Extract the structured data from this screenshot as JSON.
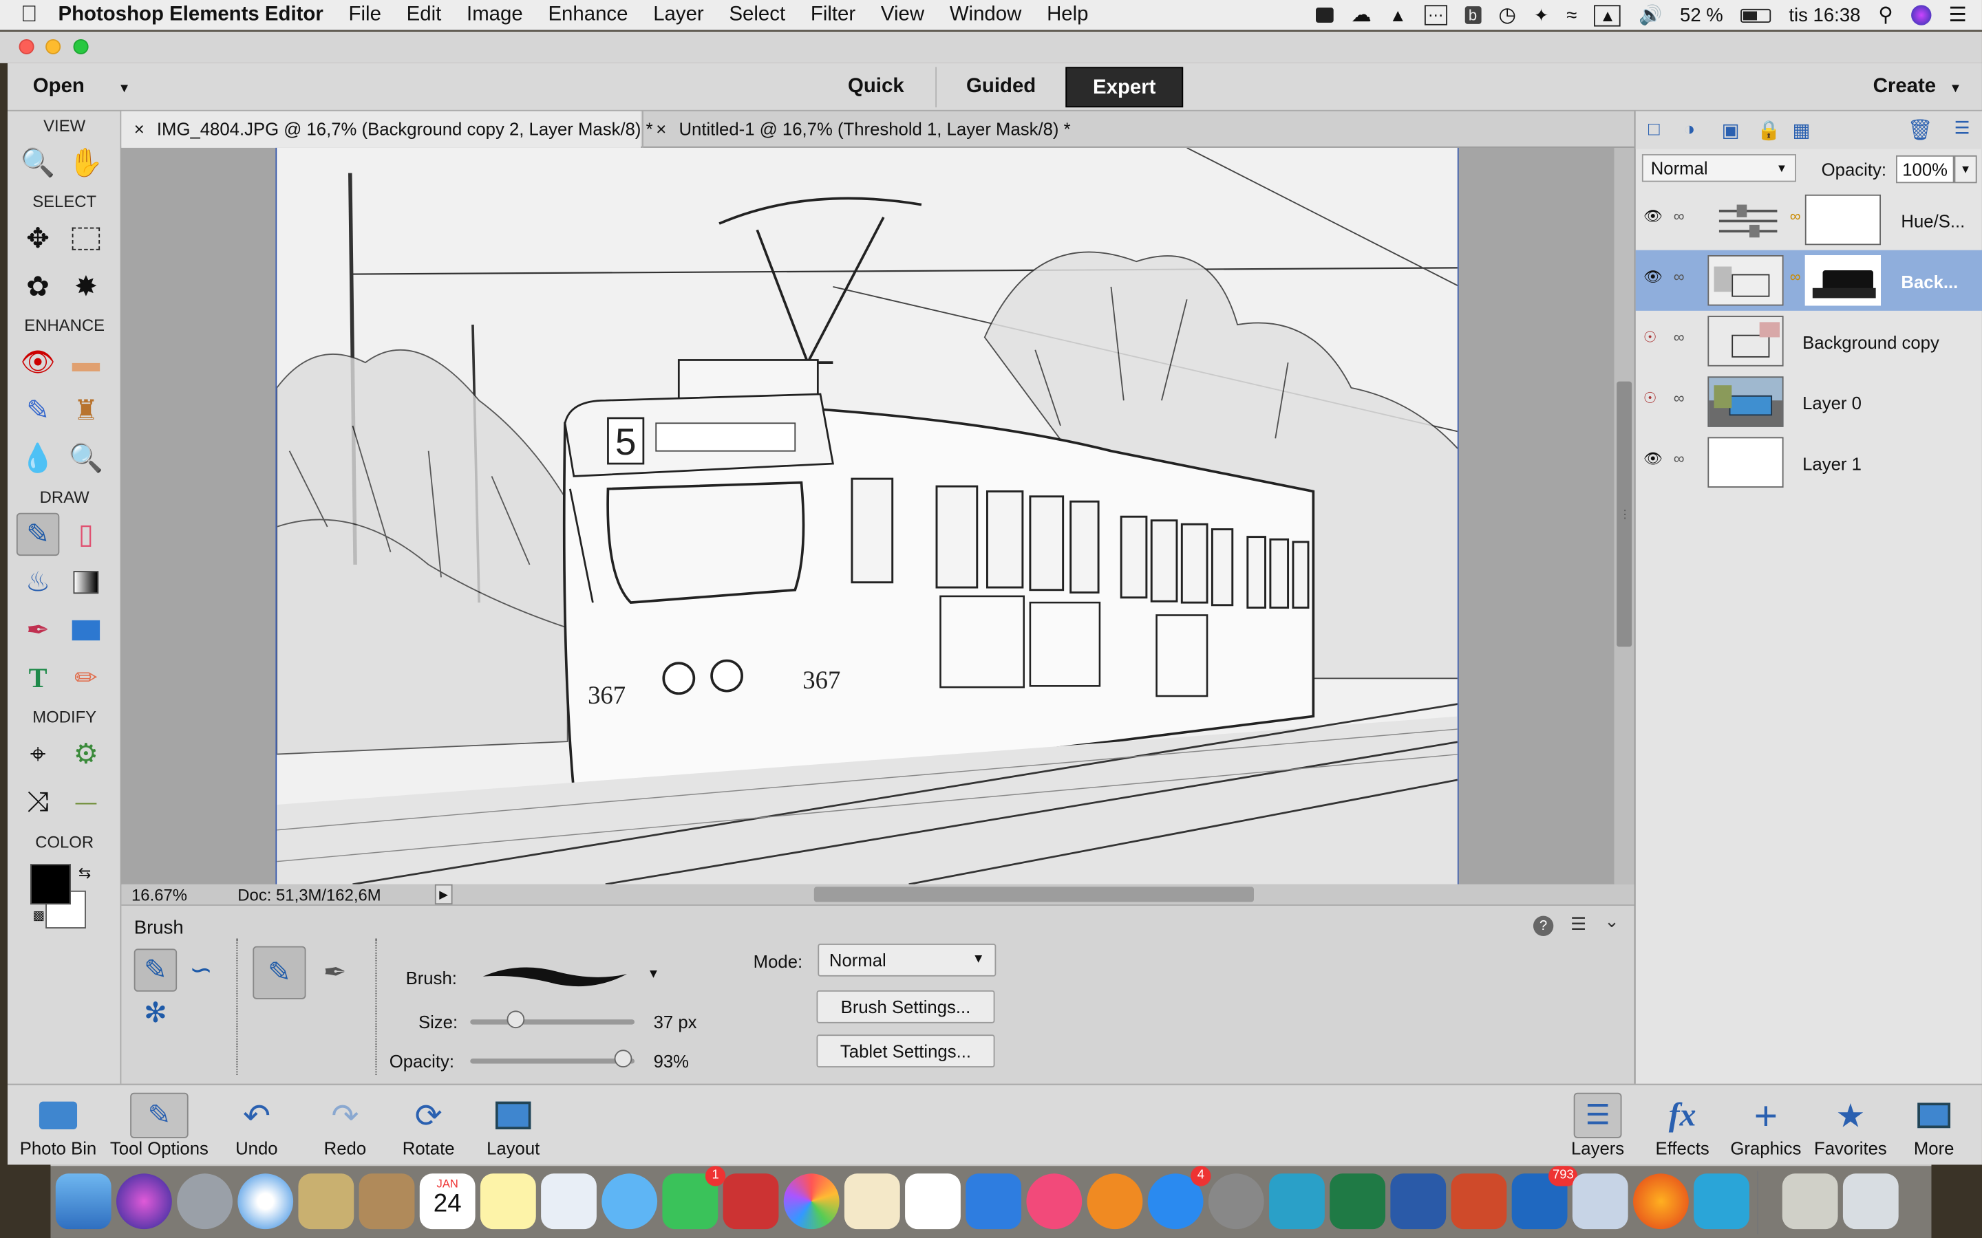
{
  "menubar": {
    "app_name": "Photoshop Elements Editor",
    "items": [
      "File",
      "Edit",
      "Image",
      "Enhance",
      "Layer",
      "Select",
      "Filter",
      "View",
      "Window",
      "Help"
    ],
    "battery": "52 %",
    "clock": "tis 16:38"
  },
  "modebar": {
    "open": "Open",
    "modes": [
      "Quick",
      "Guided",
      "Expert"
    ],
    "active_mode": "Expert",
    "create": "Create"
  },
  "toolbox": {
    "sections": [
      "VIEW",
      "SELECT",
      "ENHANCE",
      "DRAW",
      "MODIFY",
      "COLOR"
    ]
  },
  "tabs": [
    {
      "close": "×",
      "label": "IMG_4804.JPG @ 16,7% (Background copy 2, Layer Mask/8) *"
    },
    {
      "close": "×",
      "label": "Untitled-1 @ 16,7% (Threshold 1, Layer Mask/8) *"
    }
  ],
  "status": {
    "zoom": "16.67%",
    "doc": "Doc: 51,3M/162,6M"
  },
  "options": {
    "title": "Brush",
    "brush_label": "Brush:",
    "size_label": "Size:",
    "size_value": "37 px",
    "size_fraction": 0.28,
    "opacity_label": "Opacity:",
    "opacity_value": "93%",
    "opacity_fraction": 0.93,
    "mode_label": "Mode:",
    "mode_value": "Normal",
    "brush_settings": "Brush Settings...",
    "tablet_settings": "Tablet Settings..."
  },
  "layers": {
    "blend_mode": "Normal",
    "opacity_label": "Opacity:",
    "opacity_value": "100%",
    "rows": [
      {
        "name": "Hue/S...",
        "visible": true,
        "selected": false
      },
      {
        "name": "Back...",
        "visible": true,
        "selected": true
      },
      {
        "name": "Background copy",
        "visible": false,
        "selected": false
      },
      {
        "name": "Layer 0",
        "visible": false,
        "selected": false
      },
      {
        "name": "Layer 1",
        "visible": true,
        "selected": false
      }
    ]
  },
  "bottombar": {
    "left": [
      "Photo Bin",
      "Tool Options",
      "Undo",
      "Redo",
      "Rotate",
      "Layout"
    ],
    "right": [
      "Layers",
      "Effects",
      "Graphics",
      "Favorites",
      "More"
    ]
  },
  "dock": {
    "calendar_month": "JAN",
    "calendar_day": "24",
    "facetime_badge": "1",
    "appstore_badge": "4",
    "outlook_badge": "793"
  },
  "canvas": {
    "tram_route": "5",
    "tram_number_front": "367",
    "tram_number_side": "367"
  },
  "colors": {
    "menubar_bg": "#ededed",
    "panel_bg": "#d9d9d9",
    "selected_layer": "#8faedc",
    "expert_button": "#2a2a2a"
  }
}
